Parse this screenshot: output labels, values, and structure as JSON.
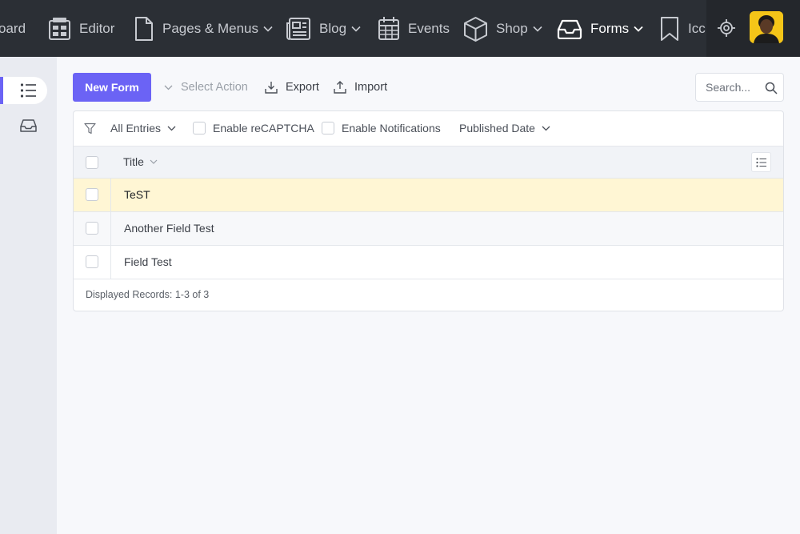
{
  "topnav": {
    "items": [
      {
        "label": "oard",
        "icon": "dashboard-icon"
      },
      {
        "label": "Editor",
        "icon": "editor-icon"
      },
      {
        "label": "Pages & Menus",
        "icon": "page-icon",
        "dropdown": true
      },
      {
        "label": "Blog",
        "icon": "newspaper-icon",
        "dropdown": true
      },
      {
        "label": "Events",
        "icon": "calendar-icon"
      },
      {
        "label": "Shop",
        "icon": "box-icon",
        "dropdown": true
      },
      {
        "label": "Forms",
        "icon": "inbox-icon",
        "dropdown": true,
        "active": true
      },
      {
        "label": "Icc",
        "icon": "bookmark-icon"
      }
    ]
  },
  "toolbar": {
    "new_form_label": "New Form",
    "select_action_label": "Select Action",
    "export_label": "Export",
    "import_label": "Import"
  },
  "search": {
    "placeholder": "Search..."
  },
  "filters": {
    "all_entries_label": "All Entries",
    "recaptcha_label": "Enable reCAPTCHA",
    "notifications_label": "Enable Notifications",
    "published_date_label": "Published Date"
  },
  "table": {
    "column_title": "Title",
    "rows": [
      {
        "title": "TeST",
        "highlighted": true
      },
      {
        "title": "Another Field Test"
      },
      {
        "title": "Field Test"
      }
    ],
    "footer": "Displayed Records: 1-3 of 3"
  },
  "colors": {
    "accent": "#6b63f5",
    "nav_bg": "#2b2f35",
    "highlight_row": "#fff6d4",
    "avatar_bg": "#f5c518"
  }
}
